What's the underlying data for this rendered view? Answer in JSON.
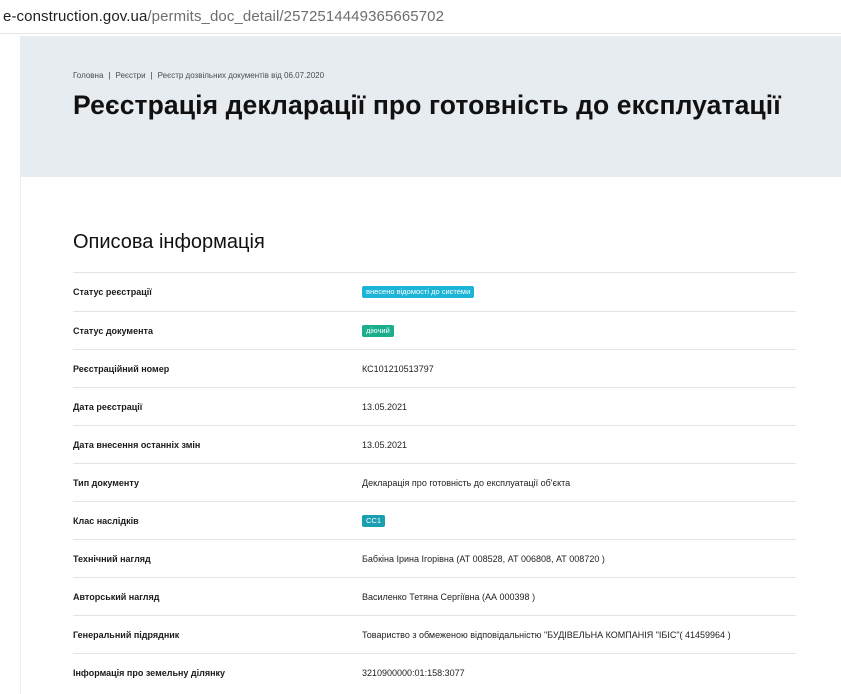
{
  "browser": {
    "url_host": "e-construction.gov.ua",
    "url_path": "/permits_doc_detail/2572514449365665702"
  },
  "breadcrumb": {
    "items": [
      "Головна",
      "Реєстри",
      "Реєстр дозвільних документів від 06.07.2020"
    ],
    "separator": "|"
  },
  "page": {
    "title": "Реєстрація декларації про готовність до експлуатації"
  },
  "section": {
    "title": "Описова інформація"
  },
  "colors": {
    "hero_bg": "#e7ecf1",
    "badge_registration": "#1cb5d8",
    "badge_document": "#1aae8a",
    "badge_class": "#1a9fb0"
  },
  "rows": [
    {
      "label": "Статус реєстрації",
      "value": "внесено відомості до системи",
      "badge": "cyan"
    },
    {
      "label": "Статус документа",
      "value": "діючий",
      "badge": "green"
    },
    {
      "label": "Реєстраційний номер",
      "value": "КС101210513797"
    },
    {
      "label": "Дата реєстрації",
      "value": "13.05.2021"
    },
    {
      "label": "Дата внесення останніх змін",
      "value": "13.05.2021"
    },
    {
      "label": "Тип документу",
      "value": "Декларація про готовність до експлуатації об'єкта"
    },
    {
      "label": "Клас наслідків",
      "value": "СС1",
      "badge": "teal"
    },
    {
      "label": "Технічний нагляд",
      "value": "Бабкіна Ірина Ігорівна (АТ 008528, АТ 006808, АТ 008720 )"
    },
    {
      "label": "Авторський нагляд",
      "value": "Василенко Тетяна Сергіївна (АА 000398 )"
    },
    {
      "label": "Генеральний підрядник",
      "value": "Товариство з обмеженою відповідальністю \"БУДІВЕЛЬНА КОМПАНІЯ \"ІБІС\"( 41459964 )"
    },
    {
      "label": "Інформація про земельну ділянку",
      "value": "3210900000:01:158:3077"
    }
  ]
}
